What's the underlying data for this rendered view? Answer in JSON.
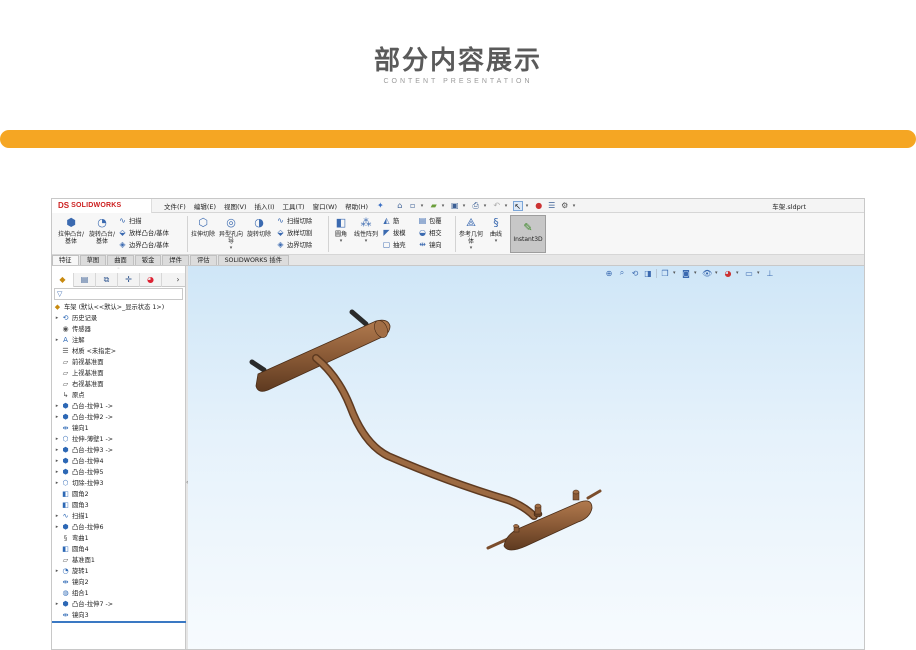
{
  "page": {
    "title": "部分内容展示",
    "subtitle": "CONTENT PRESENTATION",
    "accent_color": "#f5a623"
  },
  "app": {
    "logo_ds": "DS",
    "logo_text": "SOLIDWORKS",
    "menu": [
      "文件(F)",
      "编辑(E)",
      "视图(V)",
      "插入(I)",
      "工具(T)",
      "窗口(W)",
      "帮助(H)"
    ],
    "document_title": "车架.sldprt"
  },
  "command_manager": {
    "extrude_boss": "拉伸凸台/基体",
    "revolve_boss": "旋转凸台/基体",
    "sweep": "扫描",
    "loft": "放样凸台/基体",
    "boundary": "边界凸台/基体",
    "extrude_cut": "拉伸切除",
    "hole_wizard": "异型孔向导",
    "revolve_cut": "旋转切除",
    "sweep_cut": "扫描切除",
    "loft_cut": "放样切割",
    "boundary_cut": "边界切除",
    "fillet": "圆角",
    "linear_pattern": "线性阵列",
    "rib": "筋",
    "draft": "拔模",
    "shell": "抽壳",
    "wrap": "包覆",
    "intersect": "相交",
    "mirror": "镜向",
    "ref_geometry": "参考几何体",
    "curves": "曲线",
    "instant3d": "Instant3D"
  },
  "tabs": [
    "特征",
    "草图",
    "曲面",
    "钣金",
    "焊件",
    "评估",
    "SOLIDWORKS 插件"
  ],
  "feature_tree": {
    "root": "车架 (默认<<默认>_显示状态 1>)",
    "items": [
      {
        "label": "历史记录",
        "expandable": true,
        "icon": "history-icon"
      },
      {
        "label": "传感器",
        "expandable": false,
        "icon": "sensor-icon"
      },
      {
        "label": "注解",
        "expandable": true,
        "icon": "annotation-icon"
      },
      {
        "label": "材质 <未指定>",
        "expandable": false,
        "icon": "material-icon"
      },
      {
        "label": "前视基准面",
        "expandable": false,
        "icon": "plane-icon"
      },
      {
        "label": "上视基准面",
        "expandable": false,
        "icon": "plane-icon"
      },
      {
        "label": "右视基准面",
        "expandable": false,
        "icon": "plane-icon"
      },
      {
        "label": "原点",
        "expandable": false,
        "icon": "origin-icon"
      },
      {
        "label": "凸台-拉伸1 ->",
        "expandable": true,
        "icon": "boss-extrude-icon"
      },
      {
        "label": "凸台-拉伸2 ->",
        "expandable": true,
        "icon": "boss-extrude-icon"
      },
      {
        "label": "镜向1",
        "expandable": false,
        "icon": "mirror-icon"
      },
      {
        "label": "拉伸-薄壁1 ->",
        "expandable": true,
        "icon": "thin-extrude-icon"
      },
      {
        "label": "凸台-拉伸3 ->",
        "expandable": true,
        "icon": "boss-extrude-icon"
      },
      {
        "label": "凸台-拉伸4",
        "expandable": true,
        "icon": "boss-extrude-icon"
      },
      {
        "label": "凸台-拉伸5",
        "expandable": true,
        "icon": "boss-extrude-icon"
      },
      {
        "label": "切除-拉伸3",
        "expandable": true,
        "icon": "cut-extrude-icon"
      },
      {
        "label": "圆角2",
        "expandable": false,
        "icon": "fillet-icon"
      },
      {
        "label": "圆角3",
        "expandable": false,
        "icon": "fillet-icon"
      },
      {
        "label": "扫描1",
        "expandable": true,
        "icon": "sweep-icon"
      },
      {
        "label": "凸台-拉伸6",
        "expandable": true,
        "icon": "boss-extrude-icon"
      },
      {
        "label": "弯曲1",
        "expandable": false,
        "icon": "flex-icon"
      },
      {
        "label": "圆角4",
        "expandable": false,
        "icon": "fillet-icon"
      },
      {
        "label": "基准面1",
        "expandable": false,
        "icon": "plane-icon"
      },
      {
        "label": "旋转1",
        "expandable": true,
        "icon": "revolve-icon"
      },
      {
        "label": "镜向2",
        "expandable": false,
        "icon": "mirror-icon"
      },
      {
        "label": "组合1",
        "expandable": false,
        "icon": "combine-icon"
      },
      {
        "label": "凸台-拉伸7 ->",
        "expandable": true,
        "icon": "boss-extrude-icon"
      },
      {
        "label": "镜向3",
        "expandable": false,
        "icon": "mirror-icon"
      }
    ]
  },
  "colors": {
    "model_body": "#8a5a36",
    "model_shadow": "#5e3a20",
    "viewport_top": "#cfe6f7"
  }
}
